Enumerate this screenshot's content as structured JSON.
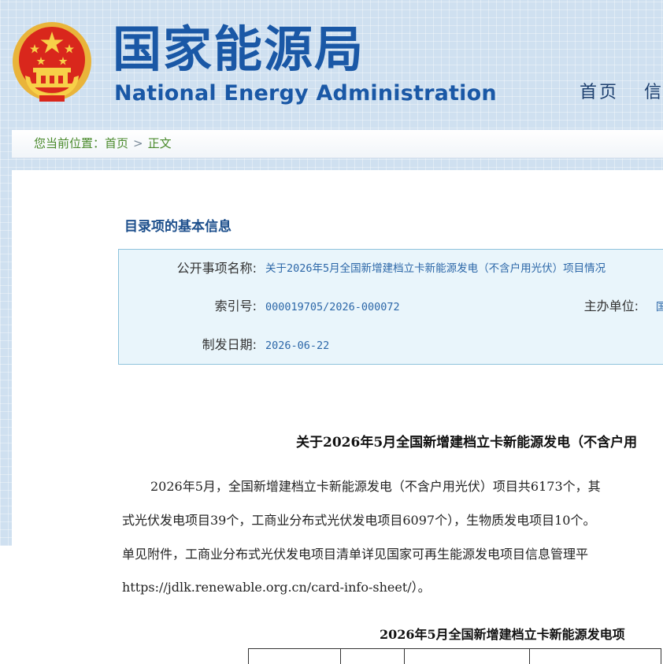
{
  "header": {
    "title_cn": "国家能源局",
    "title_en": "National Energy Administration",
    "nav": [
      "首页",
      "信"
    ]
  },
  "breadcrumb": {
    "prefix": "您当前位置：",
    "home": "首页",
    "separator": ">",
    "current": "正文"
  },
  "catalog": {
    "heading": "目录项的基本信息",
    "name_label": "公开事项名称:",
    "name_value": "关于2026年5月全国新增建档立卡新能源发电（不含户用光伏）项目情况",
    "index_label": "索引号:",
    "index_value": "000019705/2026-000072",
    "org_label": "主办单位:",
    "org_value": "国",
    "date_label": "制发日期:",
    "date_value": "2026-06-22"
  },
  "article": {
    "title": "关于2026年5月全国新增建档立卡新能源发电（不含户用",
    "lines": [
      "2026年5月，全国新增建档立卡新能源发电（不含户用光伏）项目共6173个，其",
      "式光伏发电项目39个，工商业分布式光伏发电项目6097个），生物质发电项目10个。",
      "单见附件，工商业分布式光伏发电项目清单详见国家可再生能源发电项目信息管理平",
      "https://jdlk.renewable.org.cn/card-info-sheet/）。"
    ],
    "table_title": "2026年5月全国新增建档立卡新能源发电项"
  },
  "colors": {
    "brand_blue": "#1a58a6",
    "link_blue": "#2c67a8",
    "breadcrumb_green": "#4a8a2c",
    "info_bg": "#e9f5fb",
    "info_border": "#8fc3dc"
  }
}
